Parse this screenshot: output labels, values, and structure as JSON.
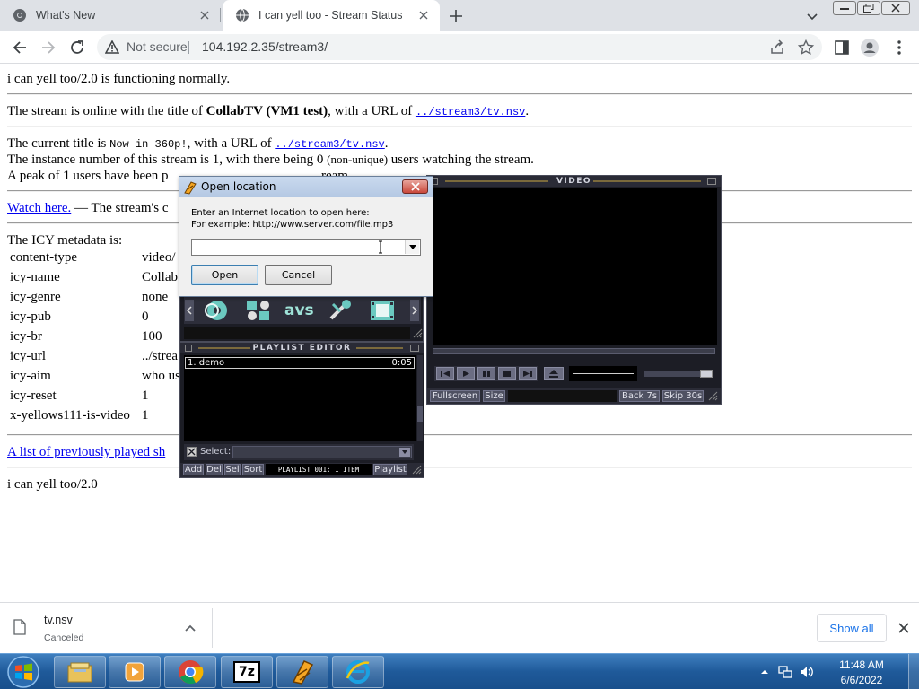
{
  "browser": {
    "tabs": [
      {
        "title": "What's New",
        "icon": "chrome-icon",
        "active": false
      },
      {
        "title": "I can yell too - Stream Status",
        "icon": "globe-icon",
        "active": true
      }
    ],
    "security_label": "Not secure",
    "url": "104.192.2.35/stream3/"
  },
  "page": {
    "status_line": "i can yell too/2.0 is functioning normally.",
    "online_prefix": "The stream is online with the title of ",
    "online_title": "CollabTV (VM1 test)",
    "online_mid": ", with a URL of ",
    "online_url": "../stream3/tv.nsv",
    "online_end": ".",
    "current_prefix": "The current title is ",
    "current_title": "Now in 360p!",
    "current_mid": ", with a URL of ",
    "current_url": "../stream3/tv.nsv",
    "current_end": ".",
    "instance_prefix": "The instance number of this stream is 1, with there being 0 ",
    "instance_small": "(non-unique)",
    "instance_end": " users watching the stream.",
    "peak_prefix": "A peak of ",
    "peak_value": "1",
    "peak_end": " users have been p",
    "peak_tail": "ream.",
    "watch_link": "Watch here.",
    "watch_text": " — The stream's c",
    "icy_heading": "The ICY metadata is:",
    "icy": [
      {
        "key": "content-type",
        "value": "video/"
      },
      {
        "key": "icy-name",
        "value": "Collab"
      },
      {
        "key": "icy-genre",
        "value": "none"
      },
      {
        "key": "icy-pub",
        "value": "0"
      },
      {
        "key": "icy-br",
        "value": "100"
      },
      {
        "key": "icy-url",
        "value": "../strea"
      },
      {
        "key": "icy-aim",
        "value": "who us"
      },
      {
        "key": "icy-reset",
        "value": "1"
      },
      {
        "key": "x-yellows111-is-video",
        "value": "1"
      }
    ],
    "history_link": "A list of previously played sh",
    "footer": "i can yell too/2.0"
  },
  "dialog": {
    "title": "Open location",
    "line1": "Enter an Internet location to open here:",
    "line2": "For example: http://www.server.com/file.mp3",
    "input_value": "",
    "open_label": "Open",
    "cancel_label": "Cancel"
  },
  "winamp": {
    "video_title": "VIDEO",
    "video_buttons": [
      "Fullscreen",
      "Size",
      "Back 7s",
      "Skip 30s"
    ],
    "playlist_title": "PLAYLIST EDITOR",
    "playlist_items": [
      {
        "name": "1. demo",
        "time": "0:05"
      }
    ],
    "select_label": "Select:",
    "pl_buttons": [
      "Add",
      "Del",
      "Sel",
      "Sort"
    ],
    "pl_info": "PLAYLIST 001: 1 ITEM",
    "pl_menu": "Playlist",
    "avs_label": "avs"
  },
  "downloads": {
    "filename": "tv.nsv",
    "status": "Canceled",
    "show_all": "Show all"
  },
  "taskbar": {
    "apps": [
      "file-explorer-icon",
      "media-player-icon",
      "chrome-icon",
      "7zip-icon",
      "winamp-icon",
      "internet-explorer-icon"
    ],
    "sevenzip_label": "7z",
    "time": "11:48 AM",
    "date": "6/6/2022"
  },
  "colors": {
    "link": "#0000ee",
    "winamp_bg": "#1c1d25",
    "taskbar": "#1f5a9a"
  }
}
